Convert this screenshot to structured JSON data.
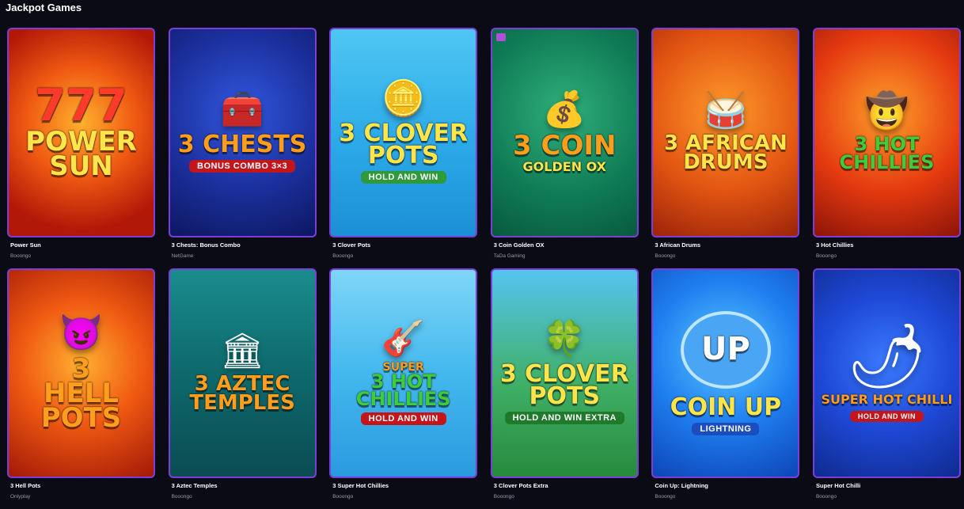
{
  "page": {
    "title": "Jackpot Games"
  },
  "games": [
    {
      "name": "Power Sun",
      "provider": "Booongo",
      "art": {
        "top": "777",
        "title": "POWER\nSUN",
        "sub": ""
      }
    },
    {
      "name": "3 Chests: Bonus Combo",
      "provider": "NetGame",
      "art": {
        "top": "",
        "title": "3 CHESTS",
        "sub": "BONUS COMBO 3×3"
      }
    },
    {
      "name": "3 Clover Pots",
      "provider": "Booongo",
      "art": {
        "top": "",
        "title": "3 CLOVER\nPOTS",
        "sub": "HOLD AND WIN"
      }
    },
    {
      "name": "3 Coin Golden OX",
      "provider": "TaDa Gaming",
      "art": {
        "top": "",
        "title": "3 COIN",
        "sub": "GOLDEN OX"
      }
    },
    {
      "name": "3 African Drums",
      "provider": "Booongo",
      "art": {
        "top": "",
        "title": "3 AFRICAN\nDRUMS",
        "sub": ""
      }
    },
    {
      "name": "3 Hot Chillies",
      "provider": "Booongo",
      "art": {
        "top": "",
        "title": "3 HOT\nCHILLIES",
        "sub": ""
      }
    },
    {
      "name": "3 Hell Pots",
      "provider": "Onlyplay",
      "art": {
        "top": "",
        "title": "3\nHELL\nPOTS",
        "sub": ""
      }
    },
    {
      "name": "3 Aztec Temples",
      "provider": "Booongo",
      "art": {
        "top": "",
        "title": "3 AZTEC\nTEMPLES",
        "sub": ""
      }
    },
    {
      "name": "3 Super Hot Chillies",
      "provider": "Booongo",
      "art": {
        "top": "SUPER",
        "title": "3 HOT\nCHILLIES",
        "sub": "HOLD AND WIN"
      }
    },
    {
      "name": "3 Clover Pots Extra",
      "provider": "Booongo",
      "art": {
        "top": "",
        "title": "3 CLOVER\nPOTS",
        "sub": "HOLD AND WIN EXTRA"
      }
    },
    {
      "name": "Coin Up: Lightning",
      "provider": "Booongo",
      "art": {
        "top": "UP",
        "title": "COIN UP",
        "sub": "LIGHTNING"
      }
    },
    {
      "name": "Super Hot Chilli",
      "provider": "Booongo",
      "art": {
        "top": "",
        "title": "SUPER HOT CHILLI",
        "sub": "HOLD AND WIN"
      }
    }
  ],
  "colors": {
    "background": "#0b0b16",
    "card_border": "#7b3fd9",
    "provider_text": "#9a9aa8"
  }
}
